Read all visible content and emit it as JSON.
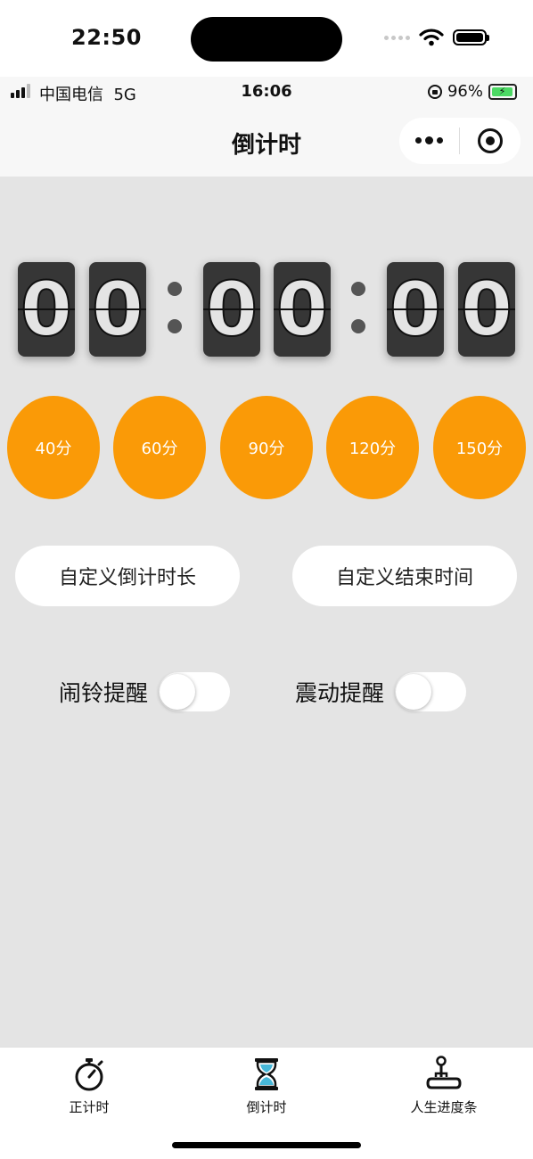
{
  "device_status": {
    "time": "22:50"
  },
  "screen_status": {
    "carrier": "中国电信",
    "network": "5G",
    "time": "16:06",
    "battery_text": "96%"
  },
  "navbar": {
    "title": "倒计时"
  },
  "timer": {
    "digits": [
      "0",
      "0",
      "0",
      "0",
      "0",
      "0"
    ]
  },
  "presets": [
    "40分",
    "60分",
    "90分",
    "120分",
    "150分"
  ],
  "custom_buttons": {
    "duration": "自定义倒计时长",
    "end_time": "自定义结束时间"
  },
  "toggles": [
    {
      "label": "闹铃提醒",
      "on": false
    },
    {
      "label": "震动提醒",
      "on": false
    }
  ],
  "tabs": [
    {
      "label": "正计时",
      "icon": "stopwatch-icon",
      "active": false
    },
    {
      "label": "倒计时",
      "icon": "hourglass-icon",
      "active": true
    },
    {
      "label": "人生进度条",
      "icon": "joystick-icon",
      "active": false
    }
  ],
  "colors": {
    "accent": "#fa9a07",
    "background": "#e4e4e4",
    "digit_tile": "#363636",
    "hourglass": "#47b7d8"
  }
}
